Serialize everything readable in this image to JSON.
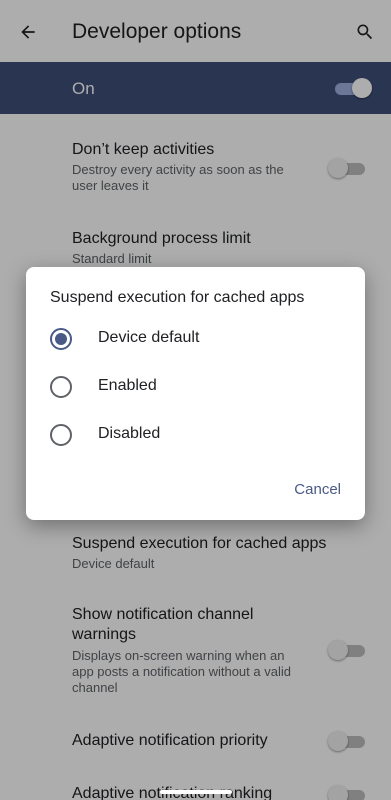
{
  "appbar": {
    "title": "Developer options",
    "back_icon": "arrow-left",
    "search_icon": "search"
  },
  "master": {
    "label": "On",
    "checked": true
  },
  "rows": [
    {
      "title": "Don’t keep activities",
      "subtitle": "Destroy every activity as soon as the user leaves it",
      "toggle": false
    },
    {
      "title": "Background process limit",
      "subtitle": "Standard limit"
    },
    {
      "title": "Suspend execution for cached apps",
      "subtitle": "Device default"
    },
    {
      "title": "Show notification channel warnings",
      "subtitle": "Displays on-screen warning when an app posts a notification without a valid channel",
      "toggle": false
    },
    {
      "title": "Adaptive notification priority",
      "toggle": false
    },
    {
      "title": "Adaptive notification ranking",
      "toggle": false
    }
  ],
  "dialog": {
    "title": "Suspend execution for cached apps",
    "options": [
      {
        "label": "Device default",
        "selected": true
      },
      {
        "label": "Enabled",
        "selected": false
      },
      {
        "label": "Disabled",
        "selected": false
      }
    ],
    "cancel_label": "Cancel"
  },
  "colors": {
    "accent": "#4a5a86",
    "master_bar": "#3f4f7a",
    "text_primary": "#202124",
    "text_secondary": "#5f6368"
  }
}
